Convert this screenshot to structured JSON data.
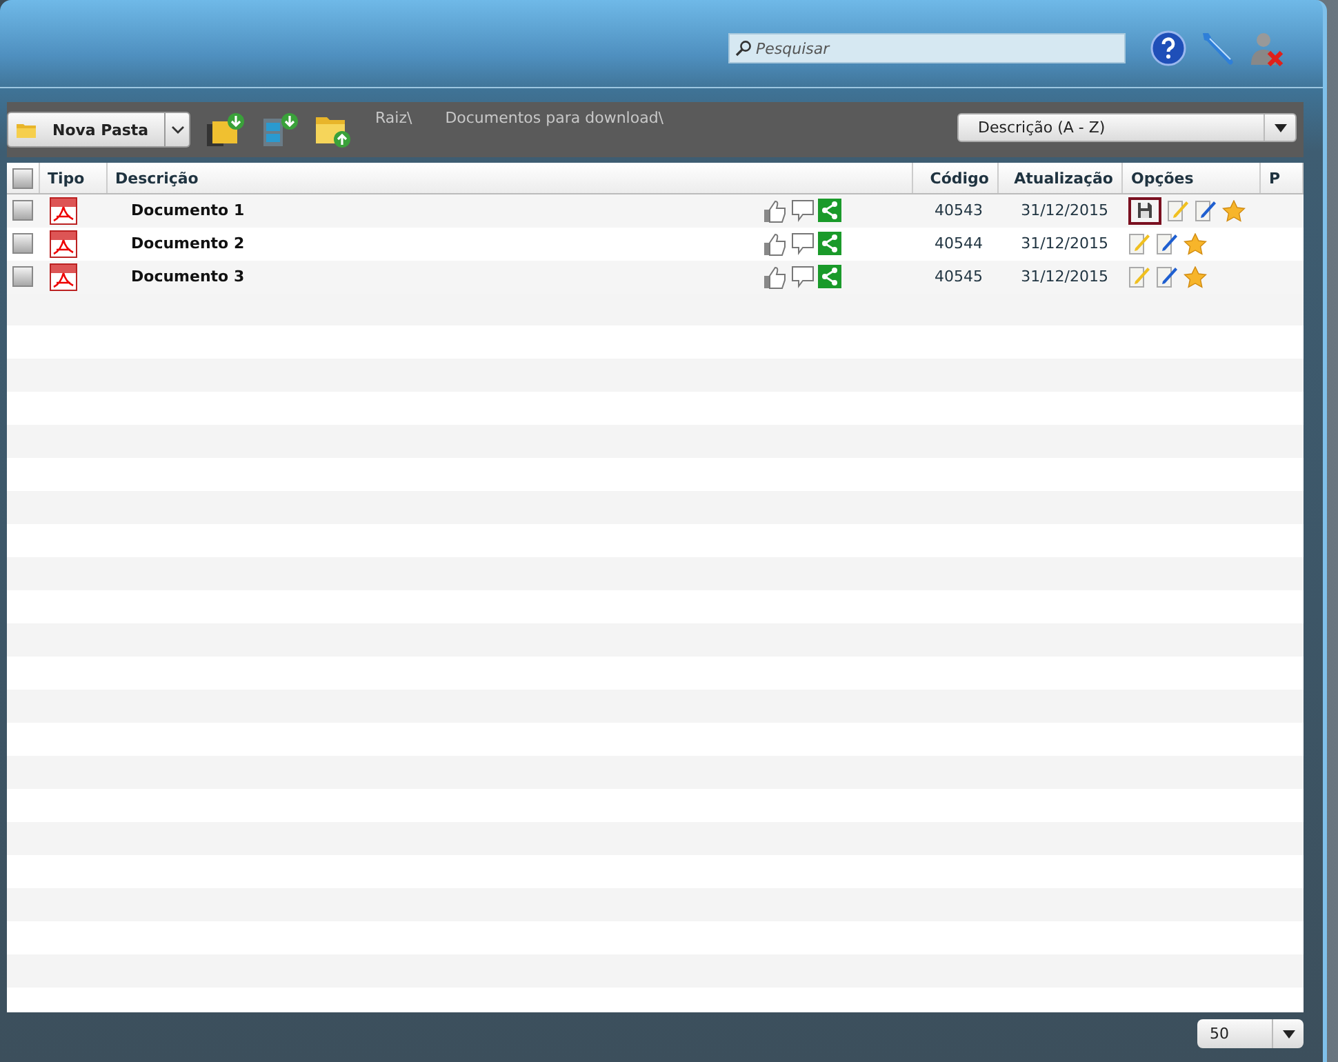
{
  "search": {
    "placeholder": "Pesquisar"
  },
  "toolbar": {
    "new_folder_button": "Nova Pasta",
    "breadcrumb": [
      "Raiz\\",
      "Documentos para download\\"
    ],
    "sort_select": "Descrição (A - Z)"
  },
  "table": {
    "header_checkbox": {
      "checked": false
    },
    "columns": [
      "Tipo",
      "Descrição",
      "Código",
      "Atualização",
      "Opções",
      "P"
    ],
    "rows": [
      {
        "checked": false,
        "name": "Documento 1",
        "code": "40543",
        "updated": "31/12/2015",
        "options": [
          {
            "kind": "save",
            "highlighted": true
          },
          {
            "kind": "edit",
            "highlighted": false
          },
          {
            "kind": "edit-blue",
            "highlighted": false
          },
          {
            "kind": "favorite",
            "highlighted": false
          }
        ]
      },
      {
        "checked": false,
        "name": "Documento 2",
        "code": "40544",
        "updated": "31/12/2015",
        "options": [
          {
            "kind": "edit",
            "highlighted": false
          },
          {
            "kind": "edit-blue",
            "highlighted": false
          },
          {
            "kind": "favorite",
            "highlighted": false
          }
        ]
      },
      {
        "checked": false,
        "name": "Documento 3",
        "code": "40545",
        "updated": "31/12/2015",
        "options": [
          {
            "kind": "edit",
            "highlighted": false
          },
          {
            "kind": "edit-blue",
            "highlighted": false
          },
          {
            "kind": "favorite",
            "highlighted": false
          }
        ]
      }
    ]
  },
  "page_size_select": "50"
}
